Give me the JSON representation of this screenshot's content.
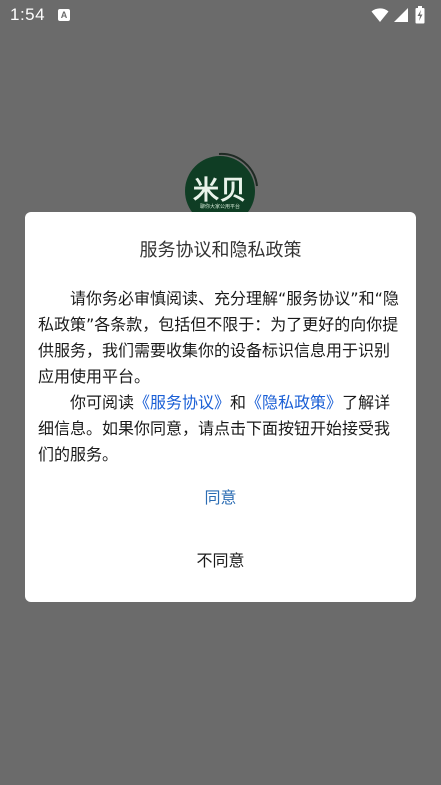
{
  "status_bar": {
    "time": "1:54",
    "notification_icon_letter": "A",
    "icons": [
      "wifi-icon",
      "signal-icon",
      "battery-charging-icon"
    ]
  },
  "splash": {
    "logo_text": "米贝",
    "logo_subtext": "聊你大家公用平台"
  },
  "dialog": {
    "title": "服务协议和隐私政策",
    "paragraph1": "请你务必审慎阅读、充分理解“服务协议”和“隐私政策”各条款，包括但不限于：为了更好的向你提供服务，我们需要收集你的设备标识信息用于识别应用使用平台。",
    "paragraph2_prefix": "你可阅读",
    "service_link": "《服务协议》",
    "and_text": "和",
    "privacy_link": "《隐私政策》",
    "paragraph2_suffix": "了解详细信息。如果你同意，请点击下面按钮开始接受我们的服务。",
    "agree_label": "同意",
    "disagree_label": "不同意"
  },
  "colors": {
    "backdrop": "#6b6b6b",
    "link": "#1a5fd6",
    "agree": "#2b6cb3",
    "logo_bg": "#0f3d24"
  }
}
